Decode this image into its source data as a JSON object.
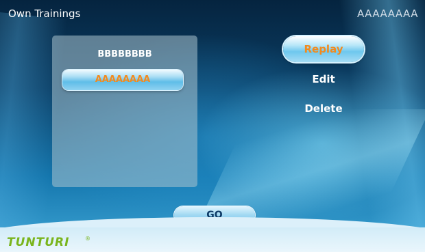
{
  "header": {
    "title": "Own Trainings",
    "user": "AAAAAAAA"
  },
  "training_list": {
    "items": [
      {
        "label": "BBBBBBBB",
        "selected": false
      },
      {
        "label": "AAAAAAAA",
        "selected": true
      }
    ]
  },
  "actions": {
    "replay": "Replay",
    "edit": "Edit",
    "delete": "Delete"
  },
  "go_label": "GO",
  "footer": {
    "brand": "TUNTURI",
    "brand_mark": "®"
  },
  "colors": {
    "accent_orange": "#f28a1e",
    "brand_green": "#7ab51d"
  }
}
